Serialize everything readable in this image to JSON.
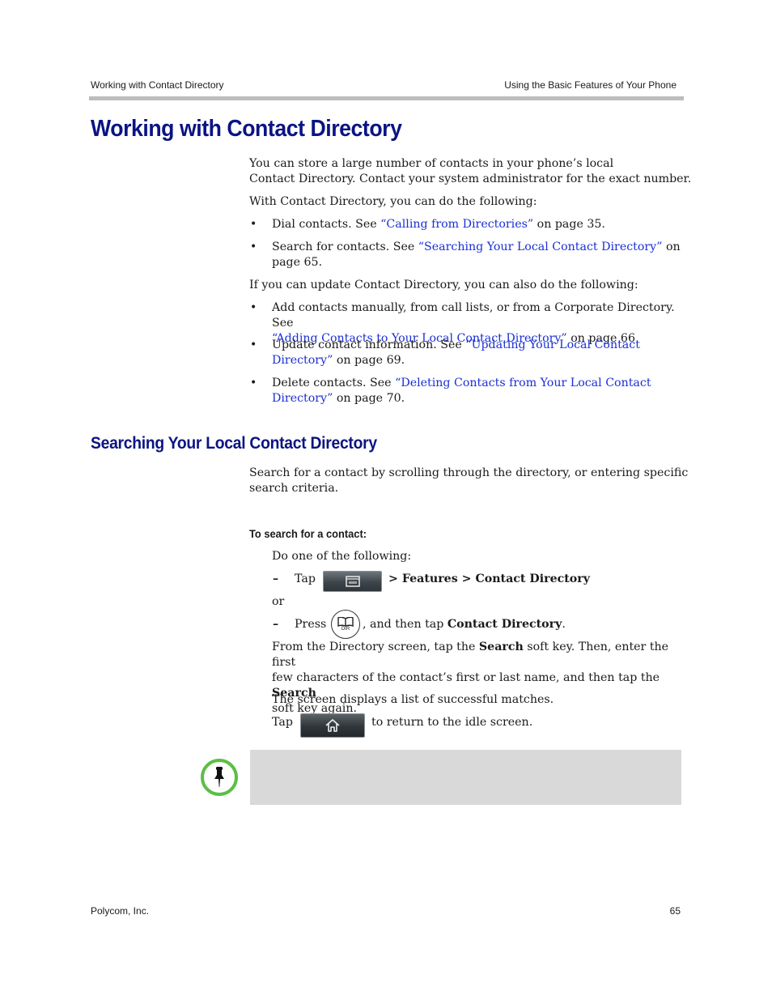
{
  "header": {
    "left": "Working with Contact Directory",
    "right": "Using the Basic Features of Your Phone"
  },
  "section1": {
    "title": "Working with Contact Directory",
    "intro_line1": "You can store a large number of contacts in your phone’s local",
    "intro_line2": "Contact Directory. Contact your system administrator for the exact number.",
    "list1_lead": "With Contact Directory, you can do the following:",
    "list1": [
      {
        "pre": "Dial contacts. See ",
        "link": "“Calling from Directories”",
        "post": " on page 35."
      },
      {
        "pre": "Search for contacts. See ",
        "link": "“Searching Your Local Contact Directory”",
        "post": " on",
        "line2": "page 65."
      }
    ],
    "list2_lead": "If you can update Contact Directory, you can also do the following:",
    "list2": [
      {
        "pre": "Add contacts manually, from call lists, or from a Corporate Directory. See",
        "link": "“Adding Contacts to Your Local Contact Directory”",
        "post": " on page 66"
      },
      {
        "pre": "Update contact information. See ",
        "link": "“Updating Your Local Contact",
        "link2": "Directory”",
        "post": " on page 69."
      },
      {
        "pre": "Delete contacts. See ",
        "link": "“Deleting Contacts from Your Local Contact",
        "link2": "Directory”",
        "post": " on page 70."
      }
    ],
    "bullet": "•"
  },
  "section2": {
    "title": "Searching Your Local Contact Directory",
    "intro_line1": "Search for a contact by scrolling through the directory, or entering specific",
    "intro_line2": "search criteria.",
    "procedure_title": "To search for a contact:",
    "step_lead": "Do one of the following:",
    "dash": "–",
    "option1_tap": "Tap",
    "option1_path": "> Features > Contact Directory",
    "option1_end": ".",
    "or": "or",
    "option2_press": "Press",
    "option2_mid": ", and then tap ",
    "option2_bold": "Contact Directory",
    "option2_end": ".",
    "dir_key_label": "DIR",
    "search_p_1": "From the Directory screen, tap the ",
    "search_bold": "Search",
    "search_p_2": " soft key. Then, enter the first",
    "search_p_3": "few characters of the contact’s first or last name, and then tap the ",
    "search_p_4": "soft key again.",
    "matches": "The screen displays a list of successful matches.",
    "home_tap": "Tap",
    "home_post": "to return to the idle screen."
  },
  "colors": {
    "heading": "#0b1482",
    "link": "#1a2fd6",
    "note_ring": "#5bbf44",
    "note_box": "#d9d9d9",
    "rule": "#bdbdbd"
  },
  "footer": {
    "left": "Polycom, Inc.",
    "page": "65"
  }
}
